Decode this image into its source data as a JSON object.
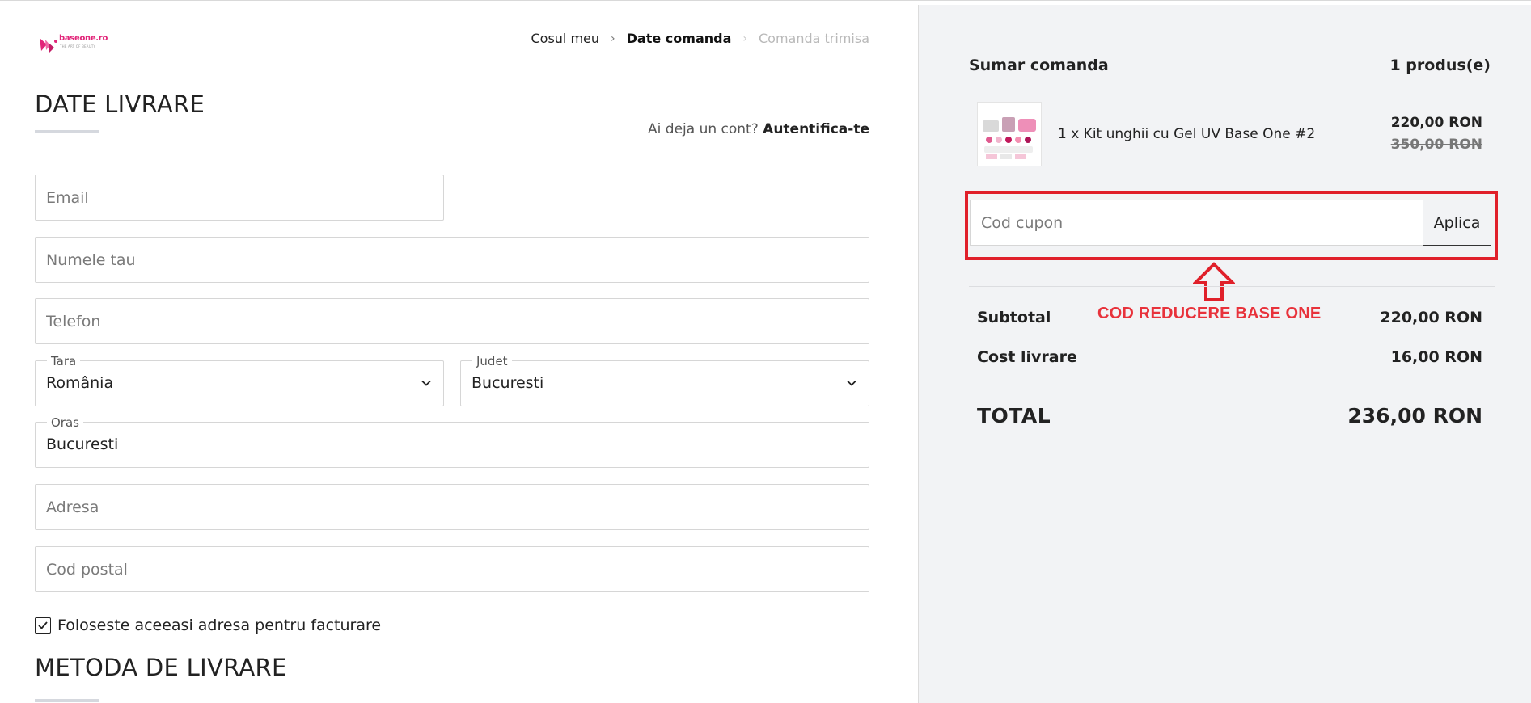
{
  "logo": {
    "word": "baseone.ro",
    "tagline": "THE ART OF BEAUTY"
  },
  "breadcrumb": {
    "items": [
      "Cosul meu",
      "Date comanda",
      "Comanda trimisa"
    ]
  },
  "delivery": {
    "title": "DATE LIVRARE",
    "login_prompt": "Ai deja un cont?",
    "login_link": "Autentifica-te",
    "email_placeholder": "Email",
    "name_placeholder": "Numele tau",
    "phone_placeholder": "Telefon",
    "country_label": "Tara",
    "country_value": "România",
    "county_label": "Judet",
    "county_value": "Bucuresti",
    "city_label": "Oras",
    "city_value": "Bucuresti",
    "address_placeholder": "Adresa",
    "postal_placeholder": "Cod postal",
    "same_billing_label": "Foloseste aceeasi adresa pentru facturare",
    "same_billing_checked": true
  },
  "shipping_method": {
    "title": "METODA DE LIVRARE"
  },
  "summary": {
    "title": "Sumar comanda",
    "count": "1 produs(e)",
    "product": {
      "name": "1 x Kit unghii cu Gel UV Base One #2",
      "price": "220,00 RON",
      "old_price": "350,00 RON"
    },
    "coupon_placeholder": "Cod cupon",
    "coupon_button": "Aplica",
    "annotation": "COD REDUCERE BASE ONE",
    "subtotal_label": "Subtotal",
    "subtotal_value": "220,00 RON",
    "shipping_label": "Cost livrare",
    "shipping_value": "16,00 RON",
    "total_label": "TOTAL",
    "total_value": "236,00 RON"
  },
  "colors": {
    "accent_red": "#e0202a",
    "brand_pink": "#e2267a",
    "panel_bg": "#f2f3f5"
  }
}
